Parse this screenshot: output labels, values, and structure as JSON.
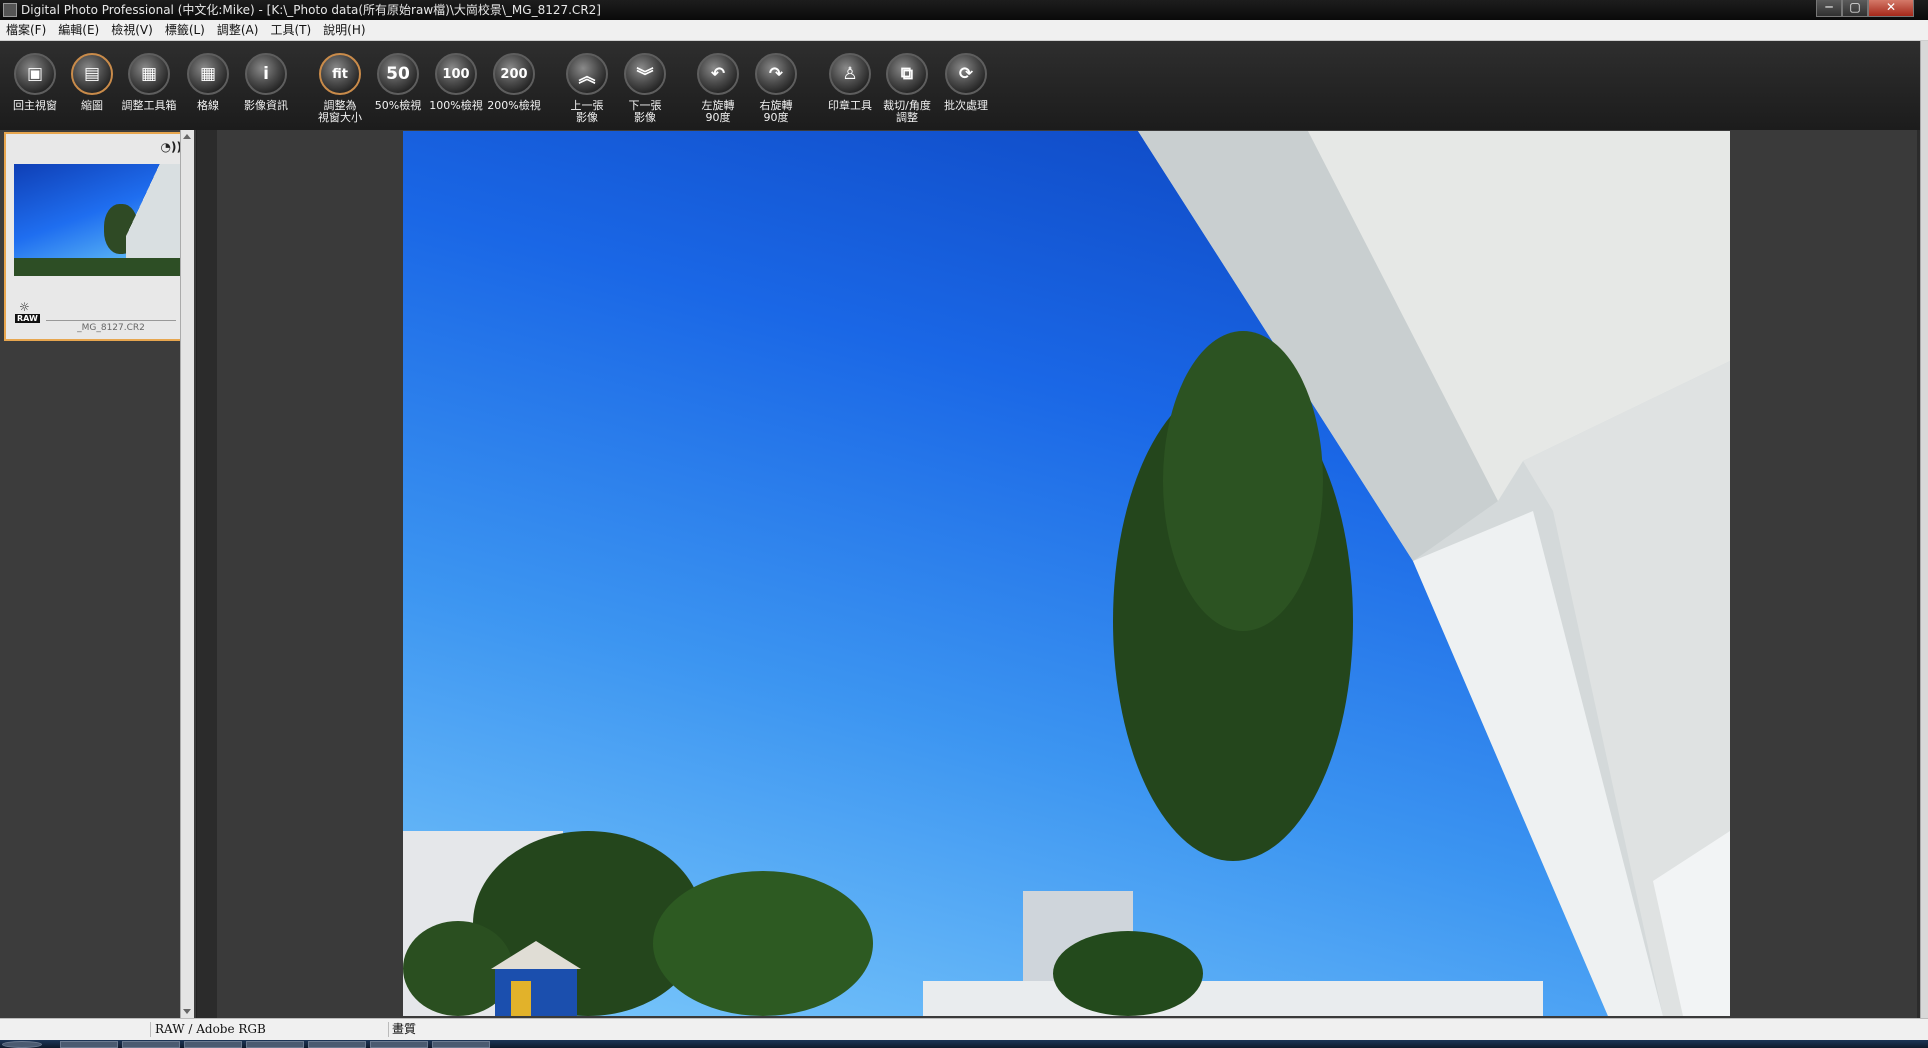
{
  "window": {
    "title": "Digital Photo Professional (中文化:Mike) - [K:\\_Photo data(所有原始raw檔)\\大崗校景\\_MG_8127.CR2]",
    "minimize": "─",
    "maximize": "▢",
    "close": "✕"
  },
  "menu": [
    "檔案(F)",
    "編輯(E)",
    "檢視(V)",
    "標籤(L)",
    "調整(A)",
    "工具(T)",
    "說明(H)"
  ],
  "toolbar": [
    {
      "label": "回主視窗",
      "icon": "folder-home-icon",
      "glyph": "▣"
    },
    {
      "label": "縮圖",
      "icon": "thumbnail-view-icon",
      "glyph": "▤",
      "active": true
    },
    {
      "label": "調整工具箱",
      "icon": "tool-palette-icon",
      "glyph": "▦"
    },
    {
      "label": "格線",
      "icon": "grid-icon",
      "glyph": "▦"
    },
    {
      "label": "影像資訊",
      "icon": "info-icon",
      "glyph": "i"
    },
    {
      "label": "調整為\n視窗大小",
      "icon": "fit-icon",
      "glyph": "fit",
      "active": true
    },
    {
      "label": "50%檢視",
      "icon": "zoom-50-icon",
      "glyph": "50"
    },
    {
      "label": "100%檢視",
      "icon": "zoom-100-icon",
      "glyph": "100"
    },
    {
      "label": "200%檢視",
      "icon": "zoom-200-icon",
      "glyph": "200"
    },
    {
      "label": "上一張\n影像",
      "icon": "previous-image-icon",
      "glyph": "︽"
    },
    {
      "label": "下一張\n影像",
      "icon": "next-image-icon",
      "glyph": "︾"
    },
    {
      "label": "左旋轉\n90度",
      "icon": "rotate-left-icon",
      "glyph": "↶"
    },
    {
      "label": "右旋轉\n90度",
      "icon": "rotate-right-icon",
      "glyph": "↷"
    },
    {
      "label": "印章工具",
      "icon": "stamp-icon",
      "glyph": "♙"
    },
    {
      "label": "裁切/角度\n調整",
      "icon": "crop-icon",
      "glyph": "⧉"
    },
    {
      "label": "批次處理",
      "icon": "batch-icon",
      "glyph": "⟳"
    }
  ],
  "thumbnail": {
    "filename": "_MG_8127.CR2",
    "raw_badge": "RAW",
    "sound_icon": "◔))",
    "sun_icon": "☼"
  },
  "status": {
    "color_space": "RAW / Adobe RGB",
    "quality": "畫質"
  },
  "colors": {
    "accent": "#e7a64f",
    "toolbar_bg": "#242424",
    "panel_bg": "#3c3c3c"
  }
}
